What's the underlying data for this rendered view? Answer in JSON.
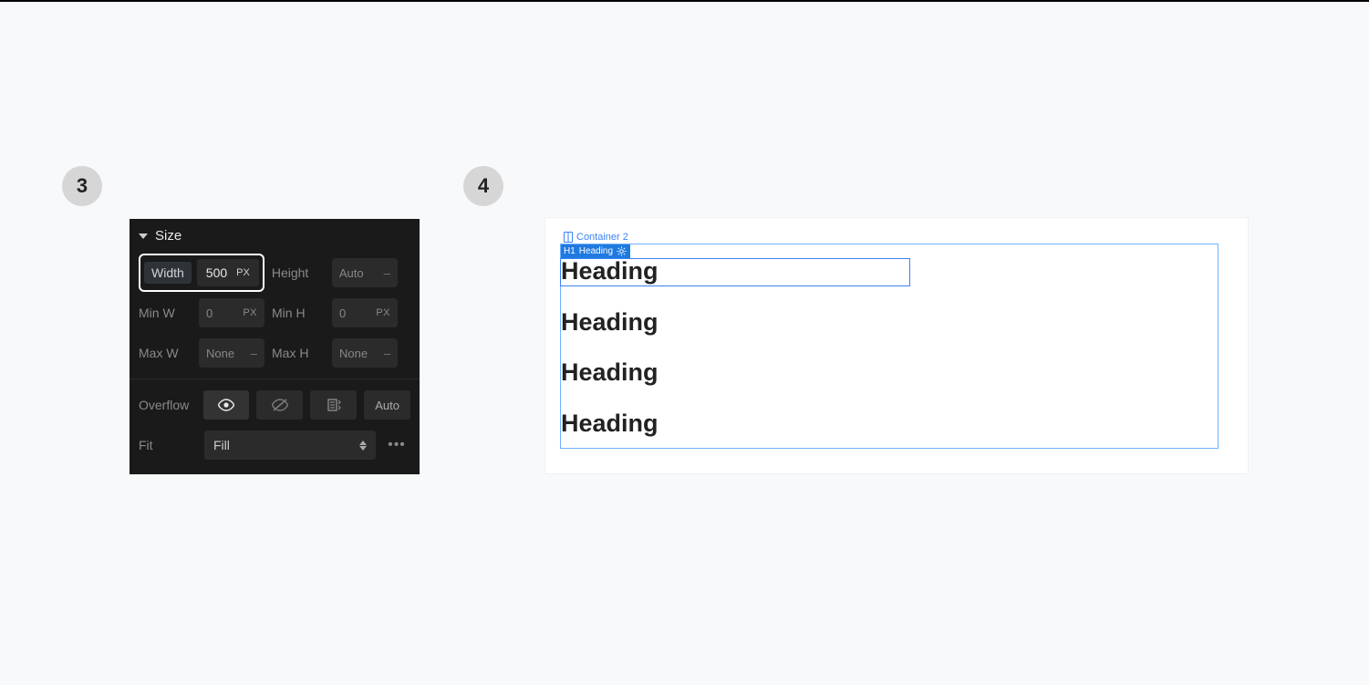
{
  "steps": {
    "three": "3",
    "four": "4"
  },
  "panel": {
    "title": "Size",
    "width": {
      "label": "Width",
      "value": "500",
      "unit": "PX"
    },
    "height": {
      "label": "Height",
      "value": "Auto",
      "unit": "–"
    },
    "minw": {
      "label": "Min W",
      "value": "0",
      "unit": "PX"
    },
    "minh": {
      "label": "Min H",
      "value": "0",
      "unit": "PX"
    },
    "maxw": {
      "label": "Max W",
      "value": "None",
      "unit": "–"
    },
    "maxh": {
      "label": "Max H",
      "value": "None",
      "unit": "–"
    },
    "overflow": {
      "label": "Overflow",
      "auto": "Auto"
    },
    "fit": {
      "label": "Fit",
      "value": "Fill"
    }
  },
  "canvas": {
    "breadcrumb": "Container 2",
    "selected": {
      "prefix": "H1",
      "name": "Heading"
    },
    "headings": [
      "Heading",
      "Heading",
      "Heading",
      "Heading"
    ]
  }
}
